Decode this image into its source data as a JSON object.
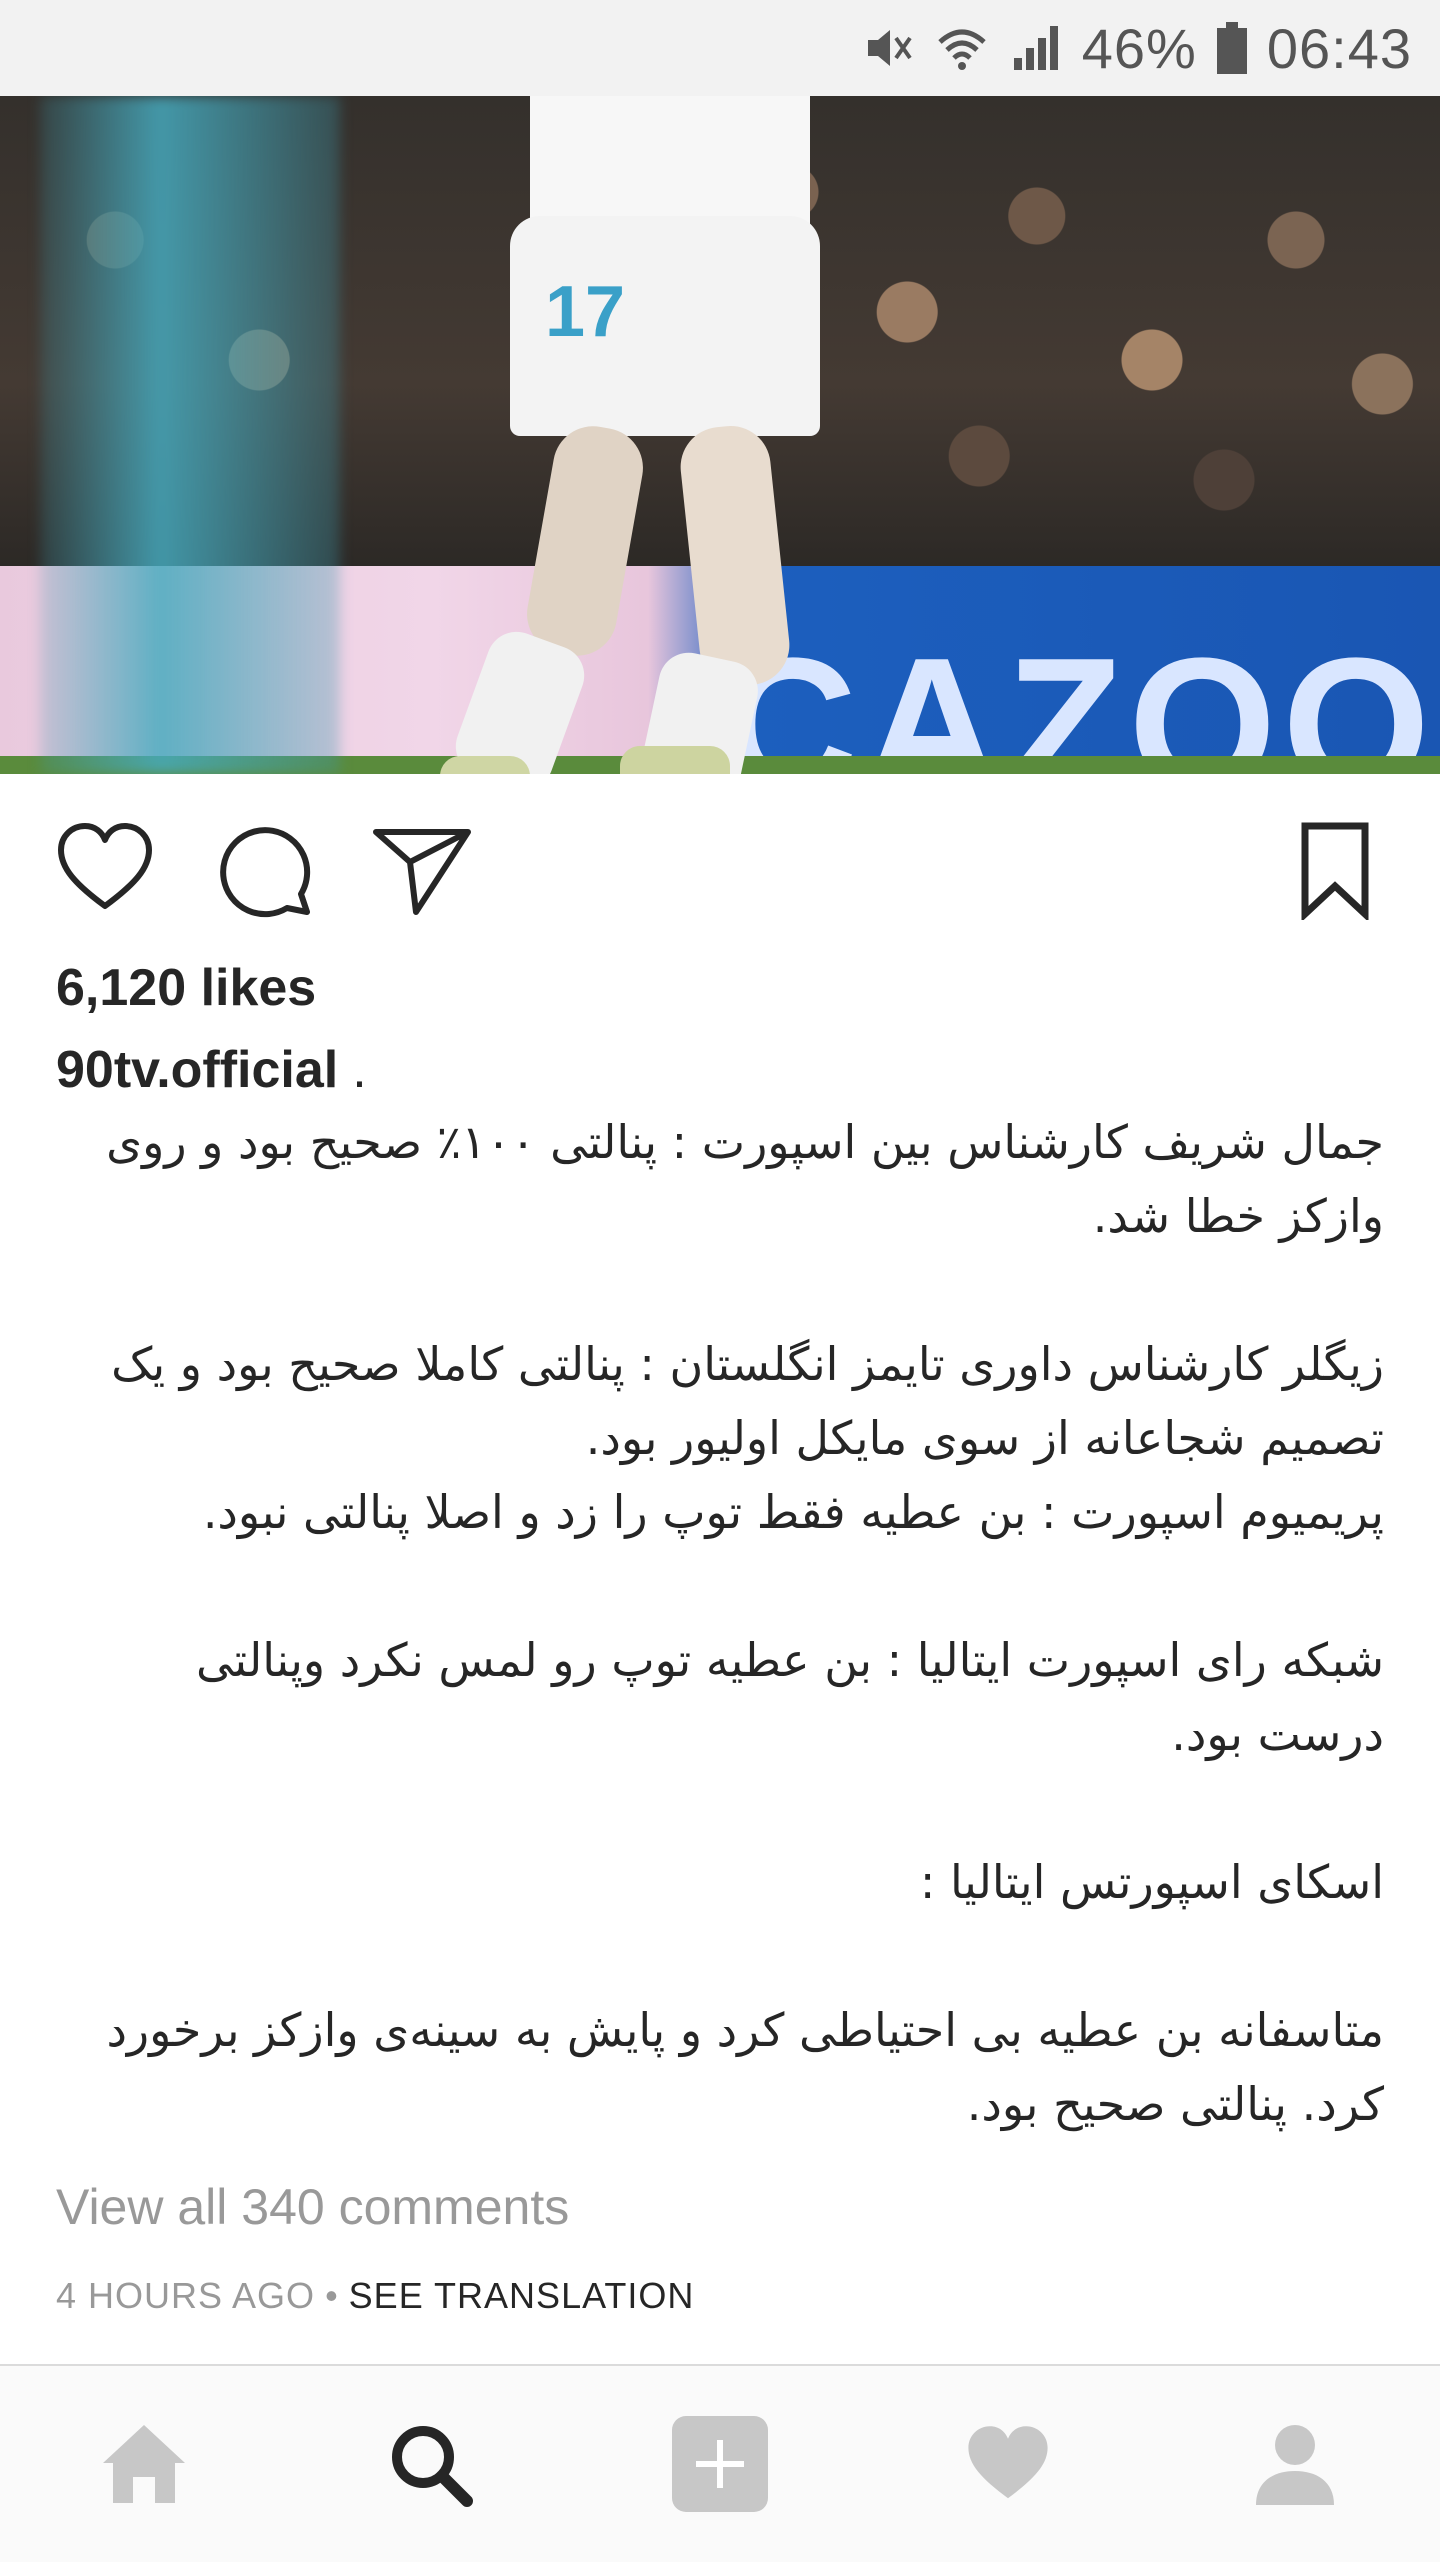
{
  "status_bar": {
    "battery_percent": "46%",
    "time": "06:43",
    "icons": [
      "mute-icon",
      "wifi-icon",
      "signal-icon",
      "battery-icon"
    ]
  },
  "post": {
    "photo_alt": "",
    "likes": "6,120 likes",
    "username": "90tv.official",
    "username_suffix": ".",
    "caption": [
      "جمال شریف کارشناس بین اسپورت : پنالتی ۱۰۰٪ صحیح بود و روی وازکز خطا شد.",
      "",
      "زیگلر کارشناس داوری تایمز انگلستان : پنالتی کاملا صحیح بود و یک تصمیم شجاعانه از سوی مایکل اولیور بود.",
      "پریمیوم اسپورت : بن عطیه فقط توپ را زد و اصلا پنالتی نبود.",
      "",
      "شبکه رای اسپورت ایتالیا : بن عطیه توپ رو لمس نکرد وپنالتی درست بود.",
      "",
      "اسکای اسپورتس ایتالیا :",
      "",
      "متاسفانه بن عطیه بی احتیاطی کرد و پایش به سینه‌ی وازکز برخورد کرد. پنالتی صحیح بود."
    ],
    "view_comments": "View all 340 comments",
    "timestamp": "4 HOURS AGO",
    "separator": "•",
    "see_translation": "SEE TRANSLATION",
    "ad_board_text": "CAZOOO"
  },
  "actions": {
    "like": "heart-icon",
    "comment": "comment-icon",
    "share": "send-icon",
    "save": "bookmark-icon"
  },
  "bottom_nav": {
    "items": [
      "home-icon",
      "search-icon",
      "add-icon",
      "heart-icon",
      "profile-icon"
    ],
    "active": "search-icon"
  },
  "colors": {
    "text": "#262626",
    "muted": "#999999",
    "nav_inactive": "#c7c7c7",
    "nav_active": "#262626",
    "status_bar_bg": "#f2f2f2"
  }
}
